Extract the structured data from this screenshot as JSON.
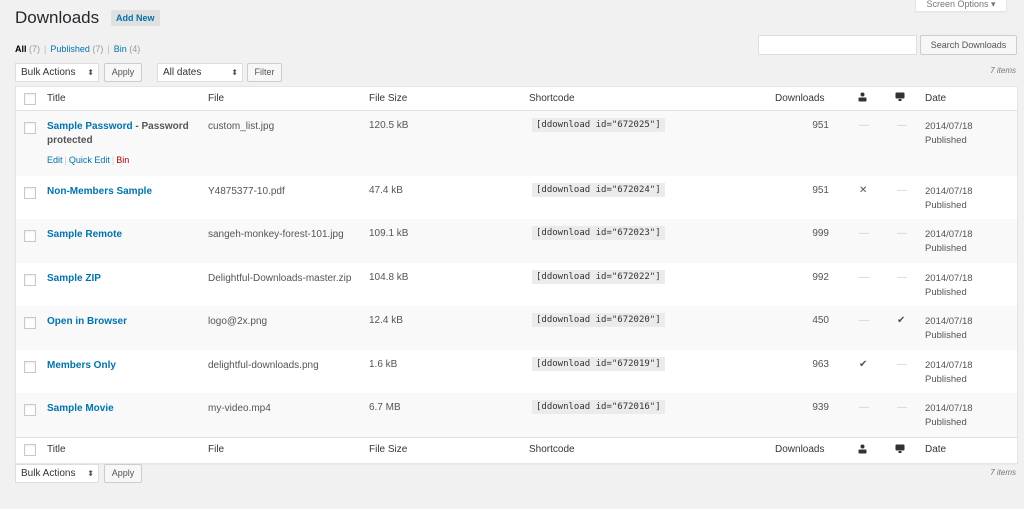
{
  "page": {
    "title": "Downloads",
    "add_new": "Add New",
    "screen_options": "Screen Options ▾"
  },
  "views": [
    {
      "label": "All",
      "count": "(7)",
      "current": true
    },
    {
      "label": "Published",
      "count": "(7)"
    },
    {
      "label": "Bin",
      "count": "(4)"
    }
  ],
  "search": {
    "value": "",
    "placeholder": "",
    "button": "Search Downloads"
  },
  "top_nav": {
    "bulk_actions": "Bulk Actions",
    "apply": "Apply",
    "dates": "All dates",
    "filter": "Filter",
    "items": "7 items"
  },
  "bottom_nav": {
    "bulk_actions": "Bulk Actions",
    "apply": "Apply",
    "items": "7 items"
  },
  "columns": {
    "title": "Title",
    "file": "File",
    "file_size": "File Size",
    "shortcode": "Shortcode",
    "downloads": "Downloads",
    "members_icon": "person-icon",
    "browser_icon": "monitor-icon",
    "date": "Date"
  },
  "row_actions": {
    "edit": "Edit",
    "quick_edit": "Quick Edit",
    "bin": "Bin"
  },
  "rows": [
    {
      "title": "Sample Password",
      "state": " - Password protected",
      "file": "custom_list.jpg",
      "size": "120.5 kB",
      "shortcode": "[ddownload id=\"672025\"]",
      "downloads": "951",
      "members": "—",
      "browser": "—",
      "date": "2014/07/18",
      "status": "Published"
    },
    {
      "title": "Non-Members Sample",
      "state": "",
      "file": "Y4875377-10.pdf",
      "size": "47.4 kB",
      "shortcode": "[ddownload id=\"672024\"]",
      "downloads": "951",
      "members": "✕",
      "browser": "—",
      "date": "2014/07/18",
      "status": "Published"
    },
    {
      "title": "Sample Remote",
      "state": "",
      "file": "sangeh-monkey-forest-101.jpg",
      "size": "109.1 kB",
      "shortcode": "[ddownload id=\"672023\"]",
      "downloads": "999",
      "members": "—",
      "browser": "—",
      "date": "2014/07/18",
      "status": "Published"
    },
    {
      "title": "Sample ZIP",
      "state": "",
      "file": "Delightful-Downloads-master.zip",
      "size": "104.8 kB",
      "shortcode": "[ddownload id=\"672022\"]",
      "downloads": "992",
      "members": "—",
      "browser": "—",
      "date": "2014/07/18",
      "status": "Published"
    },
    {
      "title": "Open in Browser",
      "state": "",
      "file": "logo@2x.png",
      "size": "12.4 kB",
      "shortcode": "[ddownload id=\"672020\"]",
      "downloads": "450",
      "members": "—",
      "browser": "✔",
      "date": "2014/07/18",
      "status": "Published"
    },
    {
      "title": "Members Only",
      "state": "",
      "file": "delightful-downloads.png",
      "size": "1.6 kB",
      "shortcode": "[ddownload id=\"672019\"]",
      "downloads": "963",
      "members": "✔",
      "browser": "—",
      "date": "2014/07/18",
      "status": "Published"
    },
    {
      "title": "Sample Movie",
      "state": "",
      "file": "my-video.mp4",
      "size": "6.7 MB",
      "shortcode": "[ddownload id=\"672016\"]",
      "downloads": "939",
      "members": "—",
      "browser": "—",
      "date": "2014/07/18",
      "status": "Published"
    }
  ],
  "colors": {
    "link": "#0073aa",
    "trash": "#a00",
    "background": "#f1f1f1"
  }
}
